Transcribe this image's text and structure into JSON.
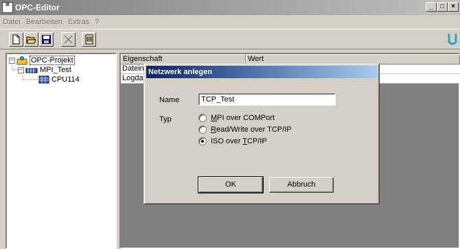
{
  "window": {
    "title": "OPC-Editor",
    "controls": [
      "_",
      "□",
      "×"
    ]
  },
  "menu": [
    "Datei",
    "Bearbeiten",
    "Extras",
    "?"
  ],
  "tree": {
    "items": [
      {
        "label": "OPC-Projekt",
        "expander": "−"
      },
      {
        "label": "MPI_Test",
        "expander": "−"
      },
      {
        "label": "CPU114"
      }
    ]
  },
  "grid": {
    "headers": [
      "Eigenschaft",
      "Wert"
    ],
    "rows": [
      [
        "Dateina",
        ""
      ],
      [
        "Logdate",
        ""
      ]
    ]
  },
  "dialog": {
    "title": "Netzwerk anlegen",
    "name_label": "Name",
    "name_value": "TCP_Test",
    "type_label": "Typ",
    "options": [
      {
        "pre": "",
        "u": "M",
        "post": "PI over COMPort",
        "selected": false
      },
      {
        "pre": "",
        "u": "R",
        "post": "ead/Write over TCP/IP",
        "selected": false
      },
      {
        "pre": "ISO over ",
        "u": "T",
        "post": "CP/IP",
        "selected": true
      }
    ],
    "ok_label": "OK",
    "cancel_label": "Abbruch"
  },
  "colors": {
    "title_active": "#0a246a",
    "title_inactive": "#808080",
    "face": "#d4d0c8",
    "logo": "#2aa8c0"
  }
}
